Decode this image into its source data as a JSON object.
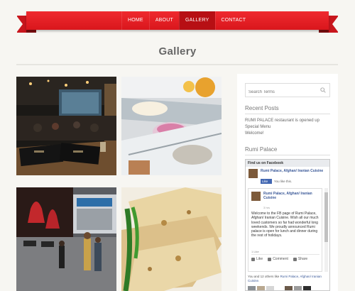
{
  "nav": {
    "items": [
      {
        "label": "HOME",
        "active": false
      },
      {
        "label": "ABOUT",
        "active": false
      },
      {
        "label": "GALLERY",
        "active": true
      },
      {
        "label": "CONTACT",
        "active": false
      }
    ]
  },
  "page": {
    "title": "Gallery"
  },
  "gallery": {
    "images": [
      "restaurant-bar-interior",
      "dessert-display-case",
      "restaurant-exterior-patio",
      "naan-bread-with-peppers"
    ]
  },
  "sidebar": {
    "search_placeholder": "Search Terms",
    "recent_posts_title": "Recent Posts",
    "posts": [
      "RUMI PALACE restaurant is opened up",
      "Special Menu",
      "Welcome!"
    ],
    "rumi_title": "Rumi Palace",
    "facebook": {
      "header": "Find us on Facebook",
      "page_name": "Rumi Palace, Afghan/ Iranian Cuisine",
      "like_button": "Like",
      "like_note": "You like this.",
      "post_author": "Rumi Palace, Afghan/ Iranian Cuisine",
      "post_time": "3 hrs",
      "post_text": "Welcome to the FB page of Rumi Palace, Afghan/ Iranian Cuisine. Wish all our much loved customers so far had wonderful long weekends. We proudly announced Rumi palace is open for lunch and dinner during the rest of holidays.",
      "post_likes": "1 Like",
      "actions": {
        "like": "Like",
        "comment": "Comment",
        "share": "Share"
      },
      "friends_prefix": "You and 12 others like",
      "friends_page": "Rumi Palace, Afghan/ Iranian Cuisine."
    }
  },
  "colors": {
    "nav_red": "#e21b22",
    "nav_active": "#b70f14",
    "background": "#f7f6f2",
    "facebook_blue": "#3b5998"
  }
}
